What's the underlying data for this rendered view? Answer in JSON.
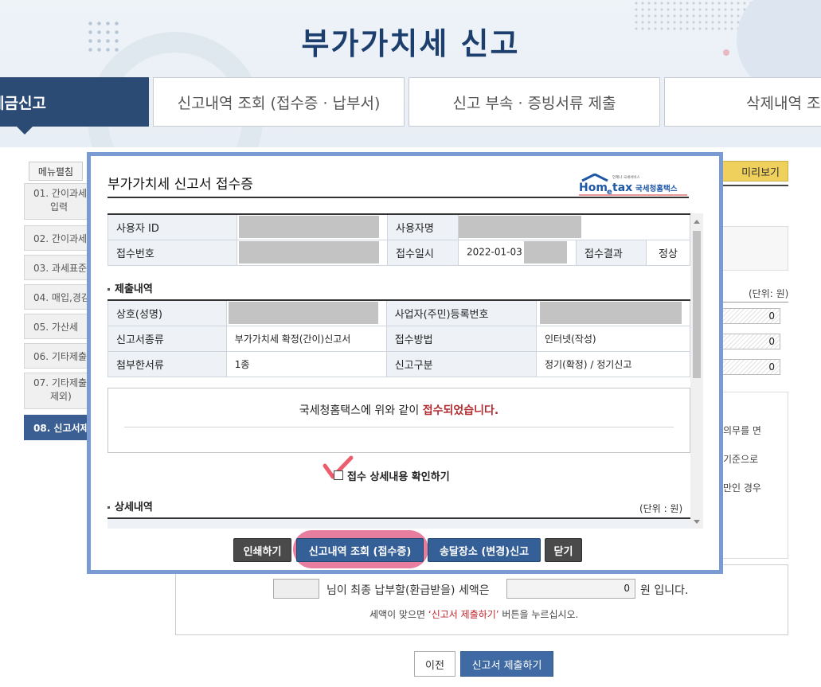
{
  "page": {
    "title": "부가가치세 신고",
    "tabs": [
      {
        "label": "세금신고",
        "active": true
      },
      {
        "label": "신고내역 조회 (접수증 · 납부서)",
        "active": false
      },
      {
        "label": "신고 부속 · 증빙서류 제출",
        "active": false
      },
      {
        "label": "삭제내역 조",
        "active": false
      }
    ],
    "menu_toggle": "메뉴펼침",
    "side_menu": [
      {
        "label": "01. 간이과세",
        "label2": "입력",
        "active": false
      },
      {
        "label": "02. 간이과세",
        "active": false
      },
      {
        "label": "03. 과세표준",
        "active": false
      },
      {
        "label": "04. 매입,경감",
        "active": false
      },
      {
        "label": "05. 가산세",
        "active": false
      },
      {
        "label": "06. 기타제출",
        "active": false
      },
      {
        "label": "07. 기타제출",
        "label2": "제외)",
        "active": false
      },
      {
        "label": "08. 신고서제",
        "active": true
      }
    ],
    "preview_label": "미리보기",
    "unit_label": "(단위: 원)",
    "right_values": [
      "0",
      "0",
      "0"
    ],
    "right_texts": [
      "의무를 면",
      "기준으로",
      "만인 경우"
    ],
    "final_text1": "님이 최종 납부할(환급받을) 세액은",
    "final_amount": "0",
    "final_text2": "원 입니다.",
    "note_prefix": "세액이 맞으면 ",
    "note_highlight": "‘신고서 제출하기’",
    "note_suffix": " 버튼을 누르십시오.",
    "prev_label": "이전",
    "submit_label": "신고서 제출하기"
  },
  "modal": {
    "title": "부가가치세 신고서 접수증",
    "logo": {
      "brand_home": "Hom",
      "brand_e": "e",
      "brand_tax": "tax",
      "brand_ko": "국세청홈택스",
      "brand_small": "언제나 국세서비스"
    },
    "receipt": {
      "user_id_label": "사용자 ID",
      "user_name_label": "사용자명",
      "receipt_no_label": "접수번호",
      "receipt_datetime_label": "접수일시",
      "receipt_datetime_value": "2022-01-03",
      "receipt_result_label": "접수결과",
      "receipt_result_value": "정상"
    },
    "submission_section": "제출내역",
    "submission": {
      "company_label": "상호(성명)",
      "bizno_label": "사업자(주민)등록번호",
      "form_type_label": "신고서종류",
      "form_type_value": "부가가치세 확정(간이)신고서",
      "method_label": "접수방법",
      "method_value": "인터넷(작성)",
      "attach_label": "첨부한서류",
      "attach_value": "1종",
      "category_label": "신고구분",
      "category_value": "정기(확정) / 정기신고"
    },
    "notice_prefix": "국세청홈택스에 위와 같이 ",
    "notice_highlight": "접수되었습니다.",
    "check_label": "접수 상세내용 확인하기",
    "detail_section": "상세내역",
    "detail_unit": "(단위 : 원)",
    "buttons": {
      "print": "인쇄하기",
      "history": "신고내역 조회 (접수증)",
      "delivery": "송달장소 (변경)신고",
      "close": "닫기"
    }
  },
  "colors": {
    "brand_navy": "#1d3f6e",
    "tab_active": "#2b4b74",
    "modal_border": "#7a9bd2",
    "accent_red": "#b22d32",
    "button_blue": "#345f97"
  }
}
